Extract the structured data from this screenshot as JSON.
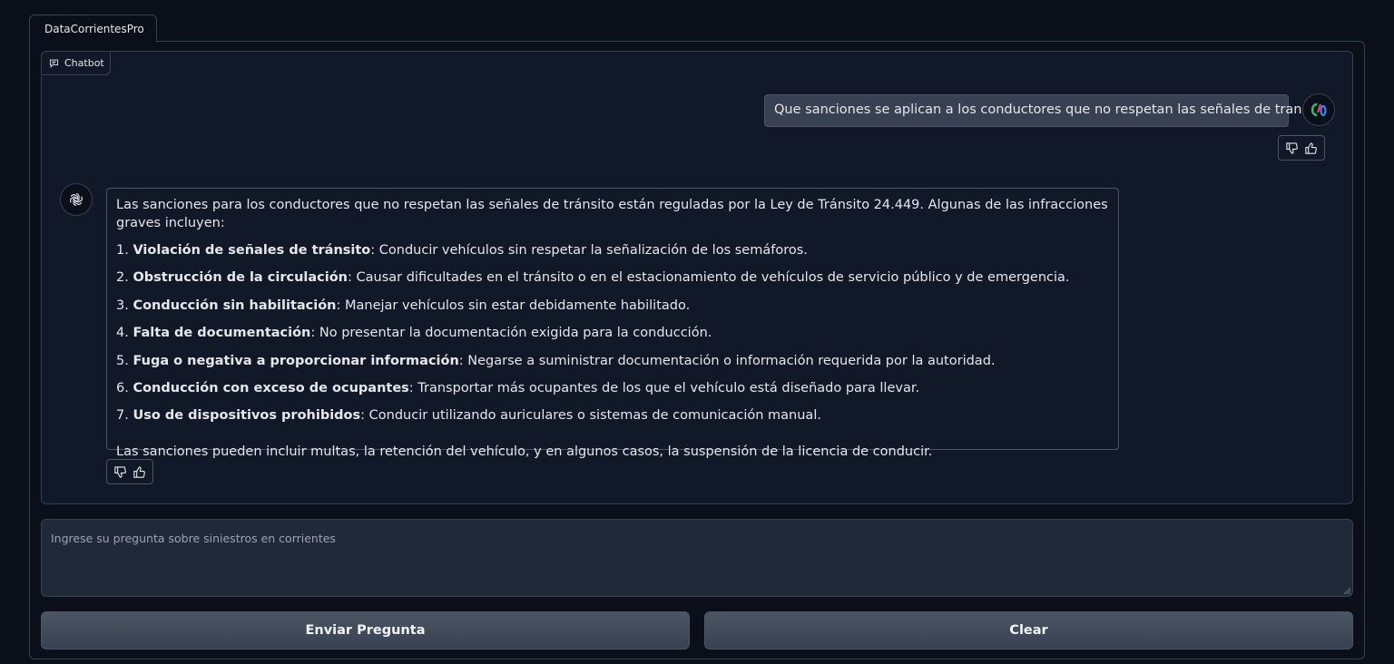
{
  "tab": {
    "label": "DataCorrientesPro"
  },
  "chatbot": {
    "label": "Chatbot",
    "user_message": "Que sanciones se aplican a los conductores que no respetan las señales de transito?",
    "bot_intro": "Las sanciones para los conductores que no respetan las señales de tránsito están reguladas por la Ley de Tránsito 24.449. Algunas de las infracciones graves incluyen:",
    "items": [
      {
        "num": "1.",
        "title": "Violación de señales de tránsito",
        "text": ": Conducir vehículos sin respetar la señalización de los semáforos."
      },
      {
        "num": "2.",
        "title": "Obstrucción de la circulación",
        "text": ": Causar dificultades en el tránsito o en el estacionamiento de vehículos de servicio público y de emergencia."
      },
      {
        "num": "3.",
        "title": "Conducción sin habilitación",
        "text": ": Manejar vehículos sin estar debidamente habilitado."
      },
      {
        "num": "4.",
        "title": "Falta de documentación",
        "text": ": No presentar la documentación exigida para la conducción."
      },
      {
        "num": "5.",
        "title": "Fuga o negativa a proporcionar información",
        "text": ": Negarse a suministrar documentación o información requerida por la autoridad."
      },
      {
        "num": "6.",
        "title": "Conducción con exceso de ocupantes",
        "text": ": Transportar más ocupantes de los que el vehículo está diseñado para llevar."
      },
      {
        "num": "7.",
        "title": "Uso de dispositivos prohibidos",
        "text": ": Conducir utilizando auriculares o sistemas de comunicación manual."
      }
    ],
    "bot_outro": "Las sanciones pueden incluir multas, la retención del vehículo, y en algunos casos, la suspensión de la licencia de conducir."
  },
  "input": {
    "placeholder": "Ingrese su pregunta sobre siniestros en corrientes",
    "value": ""
  },
  "buttons": {
    "send_label": "Enviar Pregunta",
    "clear_label": "Clear"
  },
  "icons": {
    "chat": "chat-bubble-icon",
    "user_avatar": "user-avatar-icon",
    "bot_avatar": "openai-logo-icon",
    "dislike": "thumbs-down-icon",
    "like": "thumbs-up-icon"
  }
}
